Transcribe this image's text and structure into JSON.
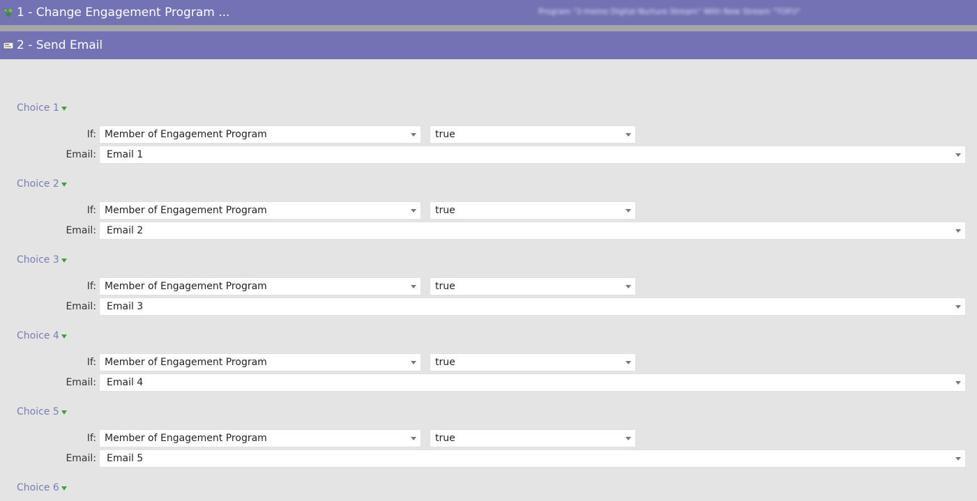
{
  "steps": [
    {
      "label": "1 - Change Engagement Program ...",
      "detail": "Program \"2-Inemo Digital Nurture Stream\" With New Stream \"TOFU\""
    },
    {
      "label": "2 - Send Email"
    }
  ],
  "icons": {
    "step1": "flowers-icon",
    "step2": "email-card-icon"
  },
  "labels": {
    "if": "If:",
    "email": "Email:"
  },
  "choices": [
    {
      "title": "Choice 1",
      "condition": "Member of Engagement Program",
      "value": "true",
      "email": "Email 1"
    },
    {
      "title": "Choice 2",
      "condition": "Member of Engagement Program",
      "value": "true",
      "email": "Email 2"
    },
    {
      "title": "Choice 3",
      "condition": "Member of Engagement Program",
      "value": "true",
      "email": "Email 3"
    },
    {
      "title": "Choice 4",
      "condition": "Member of Engagement Program",
      "value": "true",
      "email": "Email 4"
    },
    {
      "title": "Choice 5",
      "condition": "Member of Engagement Program",
      "value": "true",
      "email": "Email 5"
    },
    {
      "title": "Choice 6"
    }
  ],
  "colors": {
    "header": "#7272b4",
    "choice_title": "#7a7ab8",
    "toggle": "#3da23d"
  }
}
